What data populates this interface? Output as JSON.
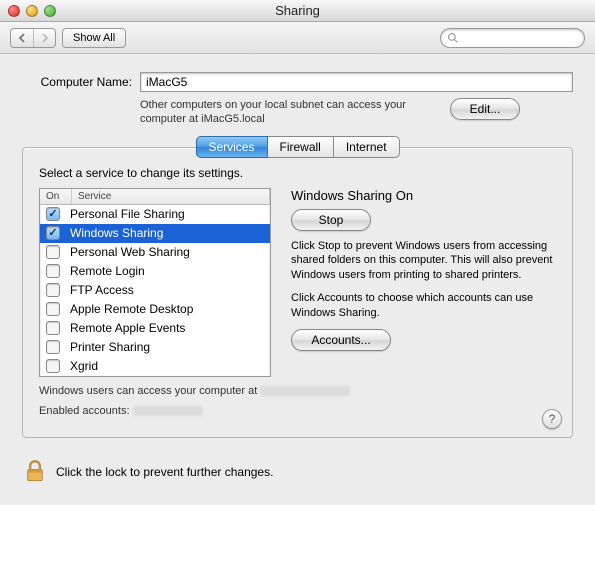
{
  "window": {
    "title": "Sharing"
  },
  "toolbar": {
    "show_all": "Show All",
    "search_placeholder": ""
  },
  "computer_name": {
    "label": "Computer Name:",
    "value": "iMacG5",
    "hint": "Other computers on your local subnet can access your computer at iMacG5.local",
    "edit_btn": "Edit..."
  },
  "tabs": {
    "services": "Services",
    "firewall": "Firewall",
    "internet": "Internet"
  },
  "services": {
    "prompt": "Select a service to change its settings.",
    "head_on": "On",
    "head_service": "Service",
    "items": [
      {
        "label": "Personal File Sharing",
        "checked": true,
        "selected": false
      },
      {
        "label": "Windows Sharing",
        "checked": true,
        "selected": true
      },
      {
        "label": "Personal Web Sharing",
        "checked": false,
        "selected": false
      },
      {
        "label": "Remote Login",
        "checked": false,
        "selected": false
      },
      {
        "label": "FTP Access",
        "checked": false,
        "selected": false
      },
      {
        "label": "Apple Remote Desktop",
        "checked": false,
        "selected": false
      },
      {
        "label": "Remote Apple Events",
        "checked": false,
        "selected": false
      },
      {
        "label": "Printer Sharing",
        "checked": false,
        "selected": false
      },
      {
        "label": "Xgrid",
        "checked": false,
        "selected": false
      }
    ]
  },
  "detail": {
    "title": "Windows Sharing On",
    "stop_btn": "Stop",
    "desc1": "Click Stop to prevent Windows users from accessing shared folders on this computer. This will also prevent Windows users from printing to shared printers.",
    "desc2": "Click Accounts to choose which accounts can use Windows Sharing.",
    "accounts_btn": "Accounts..."
  },
  "footer": {
    "line1_prefix": "Windows users can access your computer at ",
    "line2_prefix": "Enabled accounts: "
  },
  "lock": {
    "text": "Click the lock to prevent further changes."
  }
}
